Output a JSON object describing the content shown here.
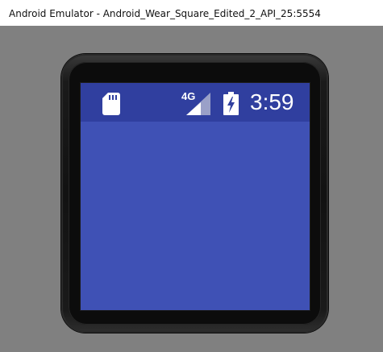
{
  "window": {
    "title": "Android Emulator - Android_Wear_Square_Edited_2_API_25:5554"
  },
  "statusbar": {
    "network_type": "4G",
    "time": "3:59",
    "icons": [
      "sd-card-icon",
      "cell-signal-icon",
      "battery-charging-icon"
    ]
  },
  "colors": {
    "screen_background": "#3f51b5",
    "statusbar_background": "#303f9f",
    "emulator_background": "#808080"
  }
}
